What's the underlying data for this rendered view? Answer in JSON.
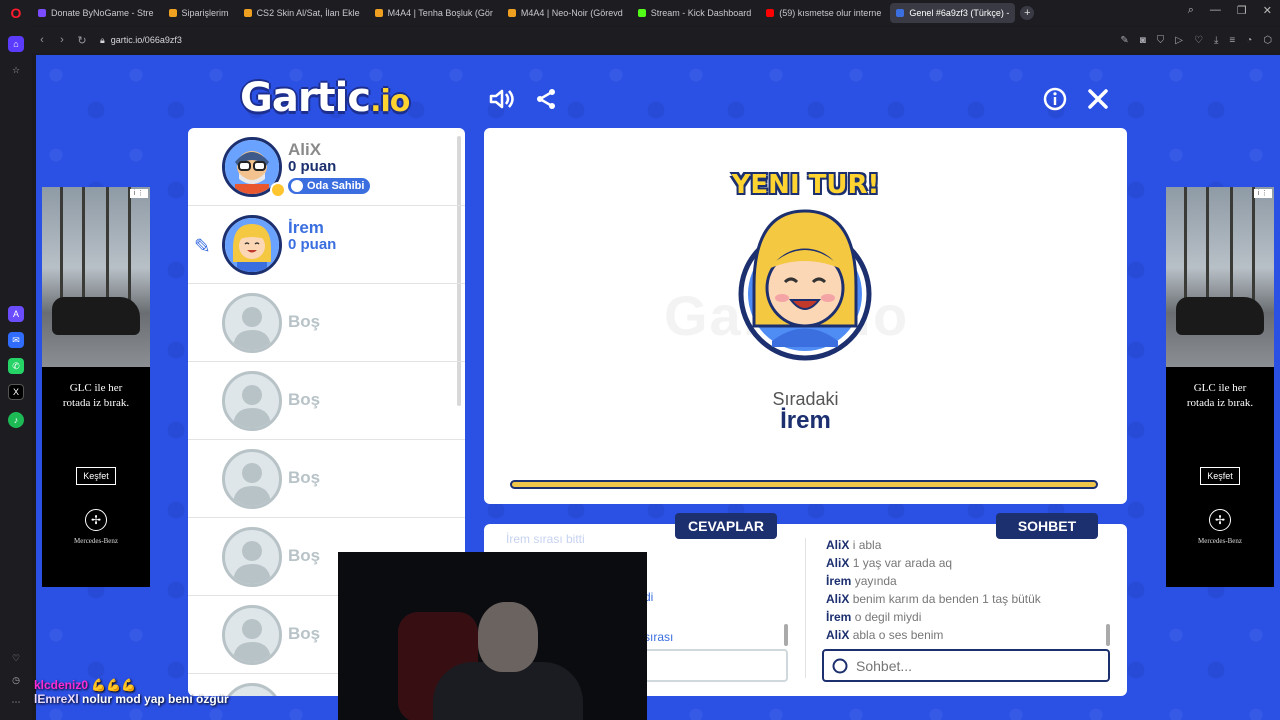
{
  "browser": {
    "tabs": [
      {
        "label": "Donate ByNoGame - Stre",
        "color": "#7b4cff"
      },
      {
        "label": "Siparişlerim",
        "color": "#f0a020"
      },
      {
        "label": "CS2 Skin Al/Sat, İlan Ekle",
        "color": "#f0a020"
      },
      {
        "label": "M4A4 | Tenha Boşluk (Gör",
        "color": "#f0a020"
      },
      {
        "label": "M4A4 | Neo-Noir (Görevd",
        "color": "#f0a020"
      },
      {
        "label": "Stream - Kick Dashboard",
        "color": "#53fc18"
      },
      {
        "label": "(59) kısmetse olur interne",
        "color": "#ff0000"
      },
      {
        "label": "Genel #6a9zf3 (Türkçe) - ",
        "color": "#3b6fe0",
        "active": true
      }
    ],
    "url": "gartic.io/066a9zf3"
  },
  "game": {
    "logo_main": "Gartic",
    "logo_suffix": ".io",
    "players": [
      {
        "name": "AliX",
        "score": "0 puan",
        "badge": "Oda Sahibi"
      },
      {
        "name": "İrem",
        "score": "0 puan"
      }
    ],
    "empty_label": "Boş",
    "stage": {
      "headline": "YENI TUR!",
      "watermark": "Gartic.io",
      "next_label": "Sıradaki",
      "next_name": "İrem"
    },
    "tabs": {
      "answers": "CEVAPLAR",
      "chat": "SOHBET"
    },
    "answer_fragments": [
      "İrem sırası bitti",
      "di",
      "sırası"
    ],
    "chat": [
      {
        "user": "AliX",
        "text": "i abla"
      },
      {
        "user": "AliX",
        "text": "1 yaş var arada aq"
      },
      {
        "user": "İrem",
        "text": "yayında"
      },
      {
        "user": "AliX",
        "text": "benim karım da benden 1 taş bütük"
      },
      {
        "user": "İrem",
        "text": "o degil miydi"
      },
      {
        "user": "AliX",
        "text": "abla o ses benim"
      }
    ],
    "chat_placeholder": "Sohbet..."
  },
  "ads": {
    "slogan_1": "GLC ile her",
    "slogan_2": "rotada iz bırak.",
    "cta": "Keşfet",
    "brand": "Mercedes-Benz"
  },
  "stream_chat": [
    {
      "user": "klcdeniz0",
      "text": "💪💪💪"
    },
    {
      "user": "lEmreXl",
      "text": "nolur mod yap beni özgür"
    }
  ]
}
